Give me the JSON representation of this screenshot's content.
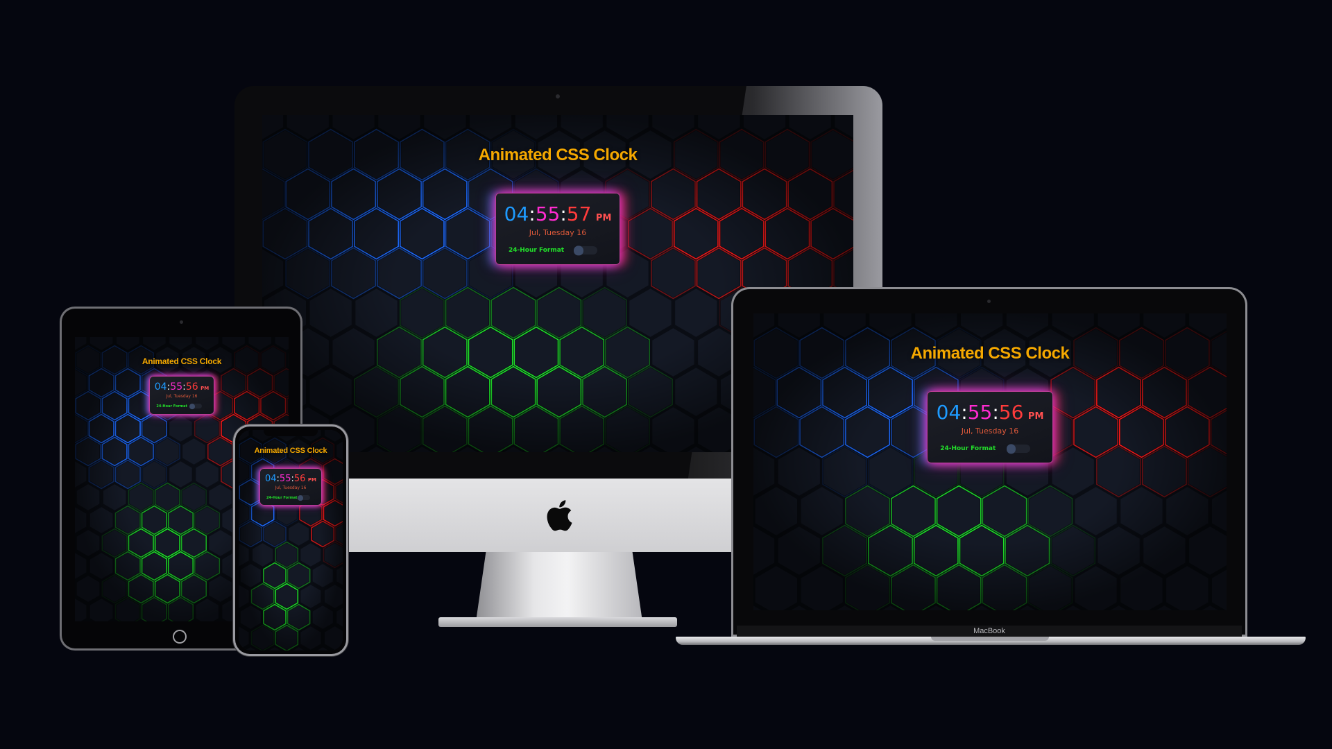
{
  "app": {
    "title": "Animated CSS Clock"
  },
  "devices": {
    "imac": {
      "clock": {
        "hh": "04",
        "mm": "55",
        "ss": "57",
        "ampm": "PM",
        "date": "Jul, Tuesday 16",
        "format_label": "24-Hour Format",
        "toggle_on": false
      }
    },
    "macbook": {
      "brand": "MacBook",
      "clock": {
        "hh": "04",
        "mm": "55",
        "ss": "56",
        "ampm": "PM",
        "date": "Jul, Tuesday 16",
        "format_label": "24-Hour Format",
        "toggle_on": false
      }
    },
    "ipad": {
      "clock": {
        "hh": "04",
        "mm": "55",
        "ss": "56",
        "ampm": "PM",
        "date": "Jul, Tuesday 16",
        "format_label": "24-Hour Format",
        "toggle_on": false
      }
    },
    "iphone": {
      "clock": {
        "hh": "04",
        "mm": "55",
        "ss": "56",
        "ampm": "PM",
        "date": "Jul, Tuesday 16",
        "format_label": "24-Hour Format",
        "toggle_on": false
      }
    }
  },
  "colors": {
    "background": "#05060f",
    "title": "#f5a800",
    "hours": "#1e9bff",
    "minutes": "#ff2bd0",
    "seconds": "#ff3b3b",
    "date": "#e05a3a",
    "format_label": "#22e02a",
    "hex_blue": "#1e6bff",
    "hex_red": "#ff1a1a",
    "hex_green": "#1fe02a"
  },
  "icons": {
    "logo": "apple-logo-icon"
  }
}
